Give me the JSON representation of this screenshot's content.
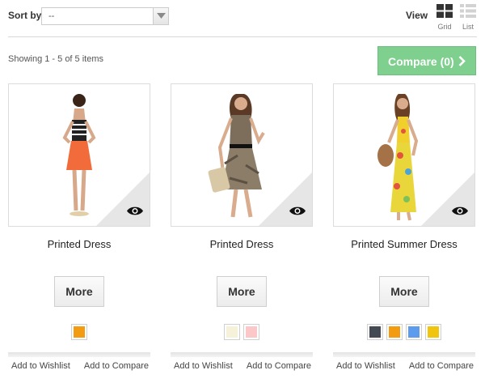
{
  "toolbar": {
    "sort_label": "Sort by",
    "sort_value": "--",
    "view_label": "View",
    "grid_label": "Grid",
    "list_label": "List"
  },
  "listing": {
    "showing_text": "Showing 1 - 5 of 5 items",
    "compare_label": "Compare (0)"
  },
  "products": [
    {
      "name": "Printed Dress",
      "more_label": "More",
      "wishlist_label": "Add to Wishlist",
      "compare_label": "Add to Compare",
      "swatches": [
        "#f39c12"
      ]
    },
    {
      "name": "Printed Dress",
      "more_label": "More",
      "wishlist_label": "Add to Wishlist",
      "compare_label": "Add to Compare",
      "swatches": [
        "#f5f2d9",
        "#fcc7c9"
      ]
    },
    {
      "name": "Printed Summer Dress",
      "more_label": "More",
      "wishlist_label": "Add to Wishlist",
      "compare_label": "Add to Compare",
      "swatches": [
        "#434a54",
        "#f39c12",
        "#5d9cec",
        "#f1c40f"
      ]
    }
  ],
  "colors": {
    "compare_green": "#7fcf8e",
    "corner_gray": "#e6e6e6"
  },
  "icons": {
    "sort_dropdown": "chevron-down-icon",
    "grid_view": "grid-icon",
    "list_view": "list-icon",
    "compare_arrow": "chevron-right-icon",
    "quick_view": "eye-icon"
  }
}
